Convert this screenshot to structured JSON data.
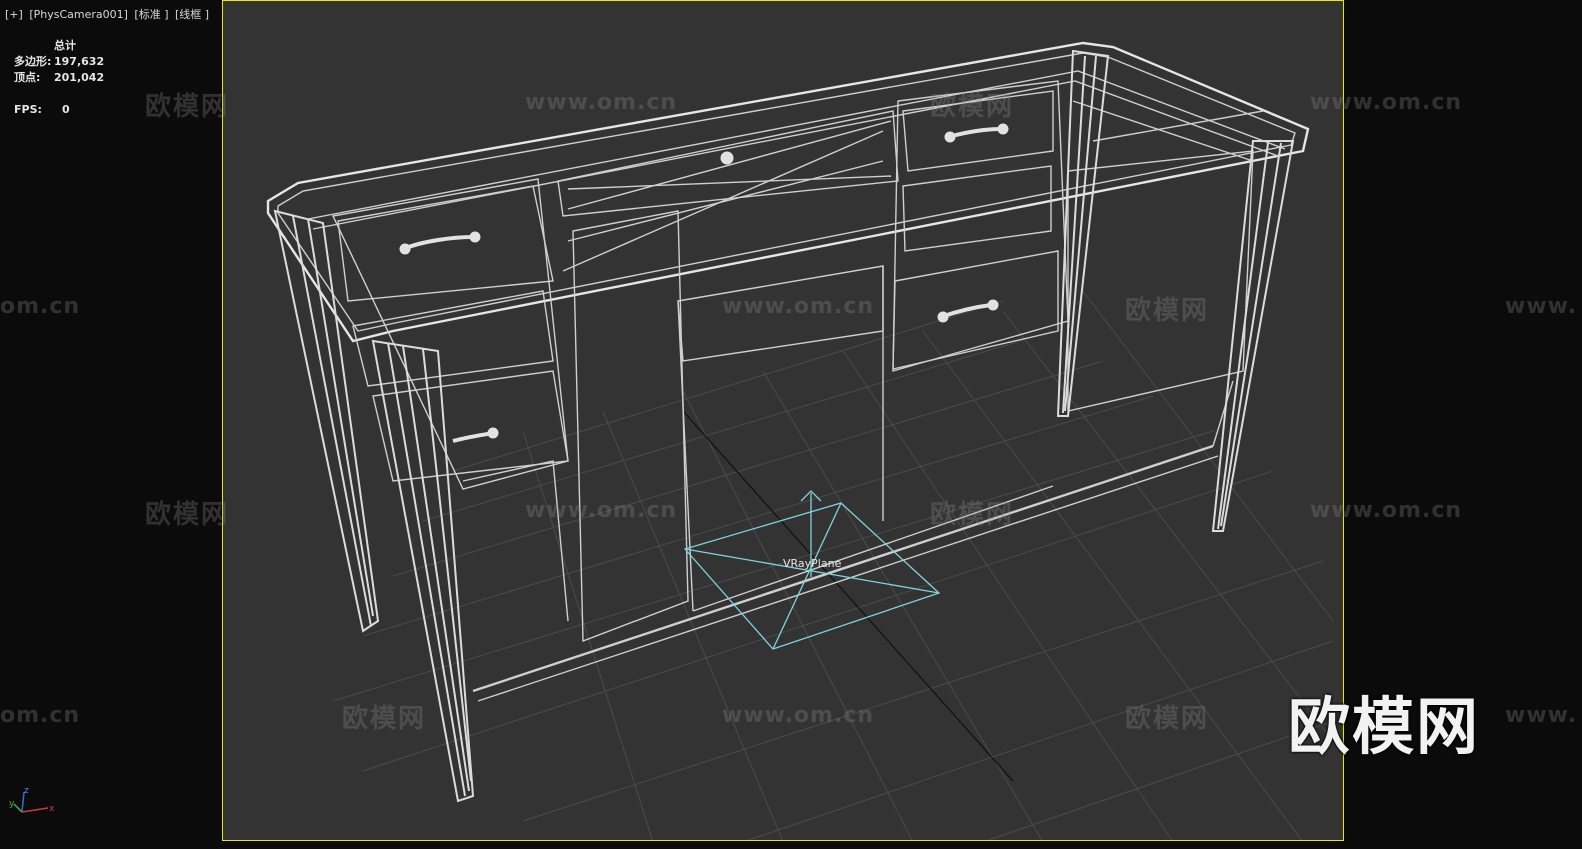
{
  "viewport": {
    "labels": [
      "[+]",
      "[PhysCamera001]",
      "[标准 ]",
      "[线框 ]"
    ],
    "accent_color": "#e8e800",
    "background_color": "#333333"
  },
  "stats": {
    "header": "总计",
    "polygons_label": "多边形:",
    "polygons_value": "197,632",
    "vertices_label": "顶点:",
    "vertices_value": "201,042",
    "fps_label": "FPS:",
    "fps_value": "0"
  },
  "scene": {
    "object_label": "VRayPlane"
  },
  "watermarks": {
    "cn": "欧模网",
    "url": "www.om.cn",
    "url_partial": "om.cn",
    "url_left": "www."
  },
  "logo": "欧模网",
  "axis": {
    "x": "x",
    "y": "y",
    "z": "z"
  }
}
